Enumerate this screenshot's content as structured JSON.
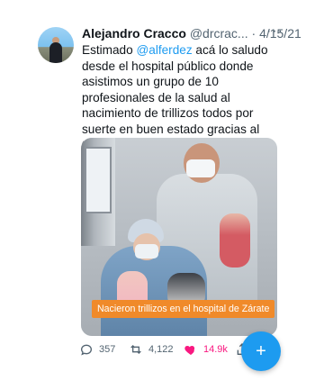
{
  "tweet": {
    "author_name": "Alejandro Cracco",
    "handle": "@drcrac...",
    "separator": "·",
    "date": "4/15/21",
    "text_before_mention": "Estimado ",
    "mention": "@alferdez",
    "text_after_mention": " acá lo saludo desde el hospital público donde asistimos un grupo de 10 profesionales de la salud al nacimiento de trillizos todos por suerte en buen estado gracias al trabajo relajado del equipo les agradecemos su preocupación",
    "media_caption": "Nacieron trillizos en el hospital de Zárate",
    "stats": {
      "replies": "357",
      "retweets": "4,122",
      "likes": "14.9k"
    }
  },
  "ui": {
    "more_glyph": "···",
    "fab_glyph": "+"
  },
  "colors": {
    "accent": "#1d9bf0",
    "like": "#f91880",
    "caption_bg": "#f08a2a",
    "secondary_text": "#536471"
  },
  "icons": [
    "more-icon",
    "reply-icon",
    "retweet-icon",
    "like-icon",
    "share-icon",
    "compose-icon"
  ]
}
